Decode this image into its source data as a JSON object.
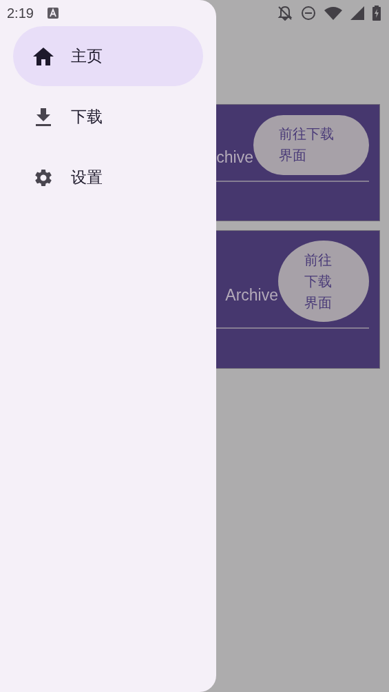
{
  "status_bar": {
    "time": "2:19"
  },
  "drawer": {
    "items": [
      {
        "label": "主页",
        "kind": "home",
        "selected": true
      },
      {
        "label": "下载",
        "kind": "download",
        "selected": false
      },
      {
        "label": "设置",
        "kind": "settings",
        "selected": false
      }
    ]
  },
  "cards": [
    {
      "text": "chive",
      "button": "前往下载界面",
      "kind": "pill"
    },
    {
      "text": "Archive",
      "button": "前往下载界面",
      "kind": "round"
    }
  ]
}
